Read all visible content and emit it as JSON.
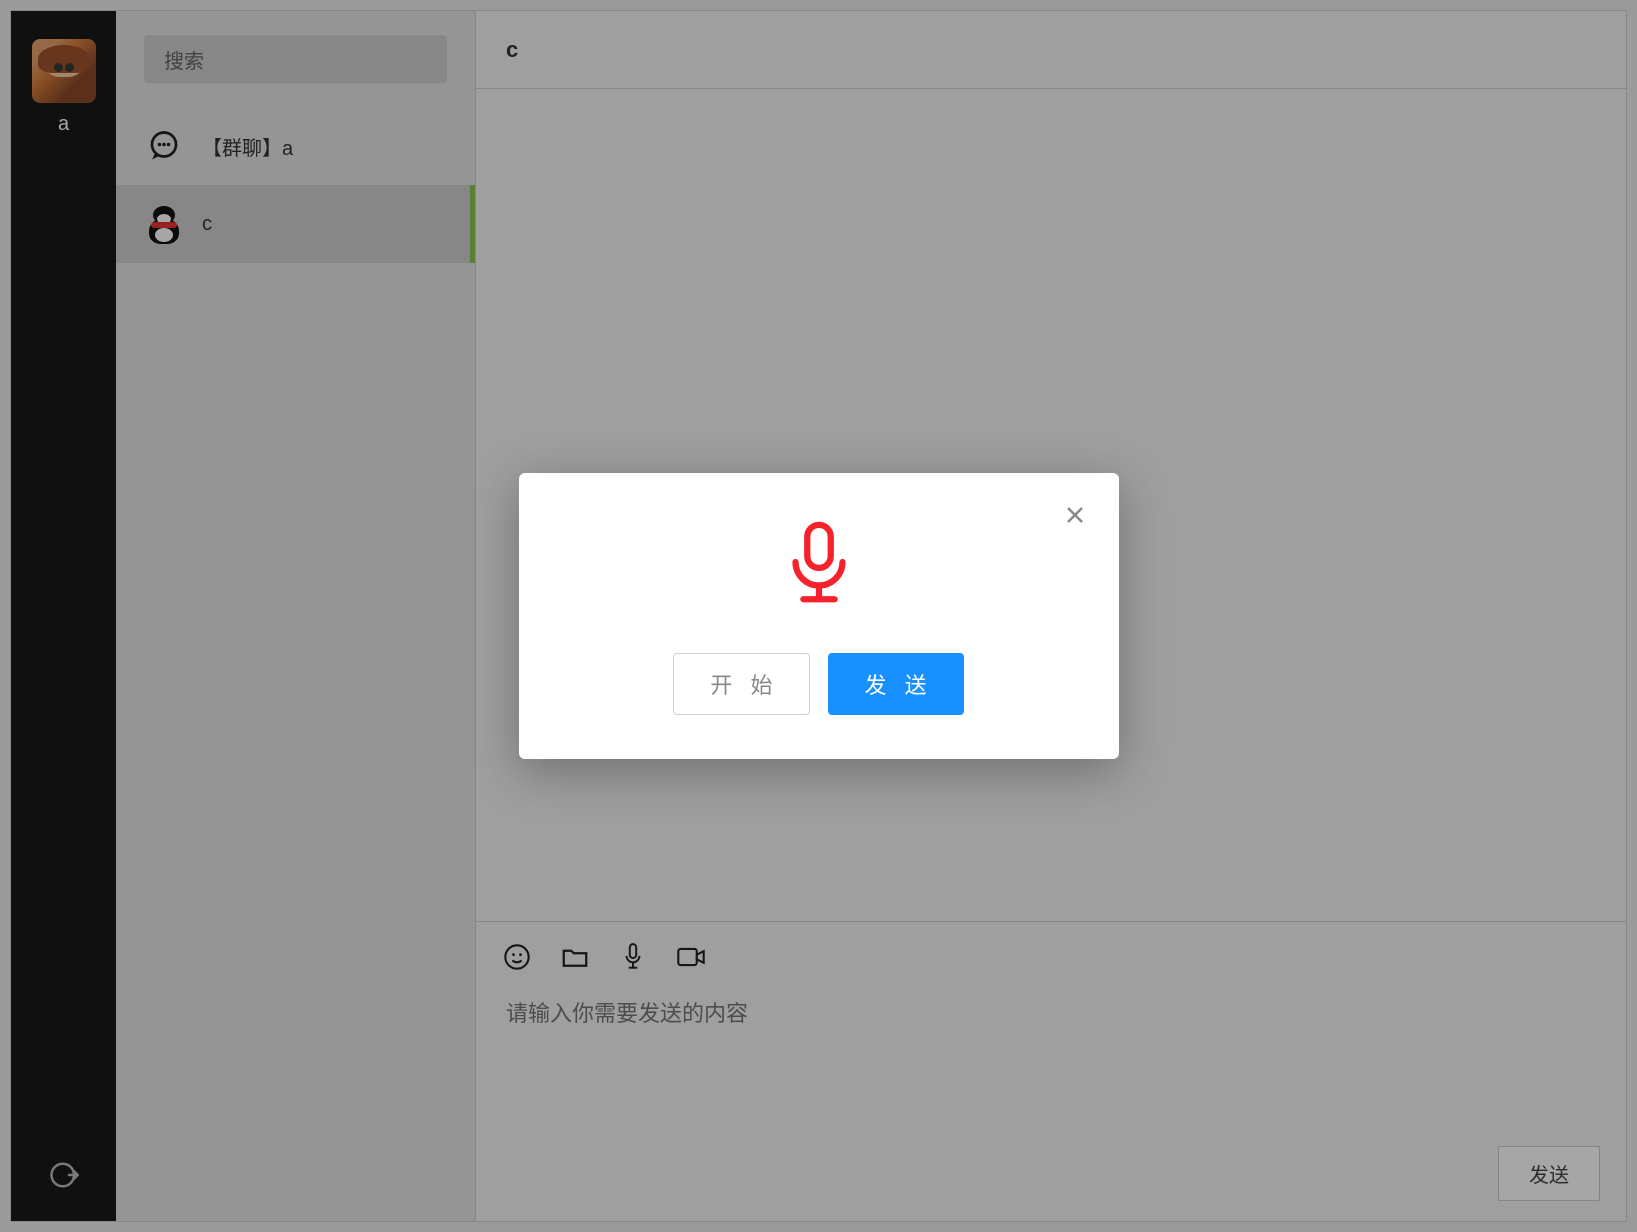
{
  "rail": {
    "username": "a"
  },
  "search": {
    "placeholder": "搜索"
  },
  "chats": {
    "groupPrefix": "【群聊】",
    "items": [
      {
        "label": "【群聊】a",
        "type": "group",
        "active": false
      },
      {
        "label": "c",
        "type": "contact",
        "active": true
      }
    ]
  },
  "chatHeader": {
    "title": "c"
  },
  "composer": {
    "placeholder": "请输入你需要发送的内容",
    "send_label": "发送"
  },
  "modal": {
    "start_label": "开 始",
    "send_label": "发 送"
  },
  "colors": {
    "primary": "#1890ff",
    "mic": "#f5222d",
    "active_stripe": "#8bc34a"
  }
}
